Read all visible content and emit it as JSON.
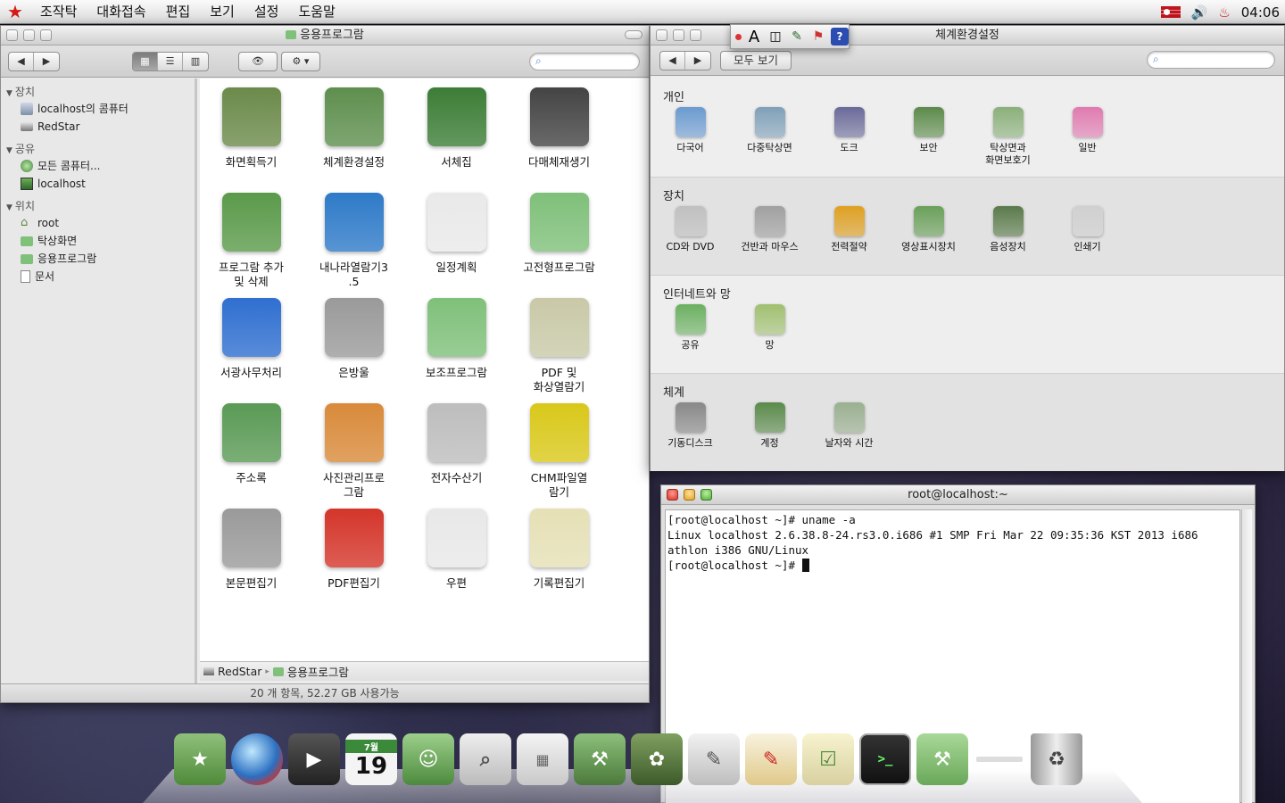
{
  "menubar": {
    "items": [
      "조작탁",
      "대화접속",
      "편집",
      "보기",
      "설정",
      "도움말"
    ],
    "clock": "04:06"
  },
  "finder": {
    "title": "응용프로그람",
    "sidebar": {
      "groups": [
        {
          "label": "장치",
          "items": [
            "localhost의 콤퓨터",
            "RedStar"
          ]
        },
        {
          "label": "공유",
          "items": [
            "모든 콤퓨터...",
            "localhost"
          ]
        },
        {
          "label": "위치",
          "items": [
            "root",
            "탁상화면",
            "응용프로그람",
            "문서"
          ]
        }
      ]
    },
    "apps": [
      {
        "label": "화면획득기",
        "icon": "camera-app-icon",
        "color": "#6b8a4a"
      },
      {
        "label": "체계환경설정",
        "icon": "settings-tools-icon",
        "color": "#5e8f4e"
      },
      {
        "label": "서체집",
        "icon": "font-book-icon",
        "color": "#3c7d36"
      },
      {
        "label": "다매체재생기",
        "icon": "media-player-icon",
        "color": "#444444"
      },
      {
        "label": "프로그람 추가\n및 삭제",
        "icon": "add-remove-icon",
        "color": "#5a9a4a"
      },
      {
        "label": "내나라열람기3\n.5",
        "icon": "browser-globe-icon",
        "color": "#2e7ac8"
      },
      {
        "label": "일정계획",
        "icon": "calendar-icon",
        "color": "#e9e9e9"
      },
      {
        "label": "고전형프로그람",
        "icon": "classic-folder-icon",
        "color": "#7fc07a"
      },
      {
        "label": "서광사무처리",
        "icon": "office-suite-icon",
        "color": "#2f6fd0"
      },
      {
        "label": "은방울",
        "icon": "lyre-icon",
        "color": "#9a9a9a"
      },
      {
        "label": "보조프로그람",
        "icon": "utilities-folder-icon",
        "color": "#7fc07a"
      },
      {
        "label": "PDF 및\n화상열람기",
        "icon": "preview-icon",
        "color": "#c9c9a8"
      },
      {
        "label": "주소록",
        "icon": "address-book-icon",
        "color": "#5a9a55"
      },
      {
        "label": "사진관리프로\n그람",
        "icon": "photo-manager-icon",
        "color": "#d98a3a"
      },
      {
        "label": "전자수산기",
        "icon": "calculator-icon",
        "color": "#bdbdbd"
      },
      {
        "label": "CHM파일열\n람기",
        "icon": "chm-viewer-icon",
        "color": "#d9c81a"
      },
      {
        "label": "본문편집기",
        "icon": "text-editor-icon",
        "color": "#9a9a9a"
      },
      {
        "label": "PDF편집기",
        "icon": "pdf-editor-icon",
        "color": "#d4352a"
      },
      {
        "label": "우편",
        "icon": "mail-icon",
        "color": "#e8e8e8"
      },
      {
        "label": "기록편집기",
        "icon": "notes-editor-icon",
        "color": "#e5e0b5"
      }
    ],
    "path": [
      "RedStar",
      "응용프로그람"
    ],
    "status": "20 개 항목, 52.27 GB 사용가능"
  },
  "prefs": {
    "title": "체계환경설정",
    "show_all": "모두 보기",
    "sections": [
      {
        "title": "개인",
        "items": [
          "다국어",
          "다중탁상면",
          "도크",
          "보안",
          "탁상면과\n화면보호기",
          "일반"
        ]
      },
      {
        "title": "장치",
        "items": [
          "CD와 DVD",
          "건반과 마우스",
          "전력절약",
          "영상표시장치",
          "음성장치",
          "인쇄기"
        ]
      },
      {
        "title": "인터네트와 망",
        "items": [
          "공유",
          "망"
        ]
      },
      {
        "title": "체계",
        "items": [
          "기동디스크",
          "계정",
          "날자와 시간"
        ]
      }
    ]
  },
  "terminal": {
    "title": "root@localhost:~",
    "lines": [
      "[root@localhost ~]# uname -a",
      "Linux localhost 2.6.38.8-24.rs3.0.i686 #1 SMP Fri Mar 22 09:35:36 KST 2013 i686",
      "athlon i386 GNU/Linux"
    ],
    "prompt": "[root@localhost ~]# "
  },
  "palette": {
    "text_tool": "A"
  },
  "dock": {
    "calendar_month": "7월",
    "calendar_day": "19",
    "terminal_prompt": ">_"
  }
}
